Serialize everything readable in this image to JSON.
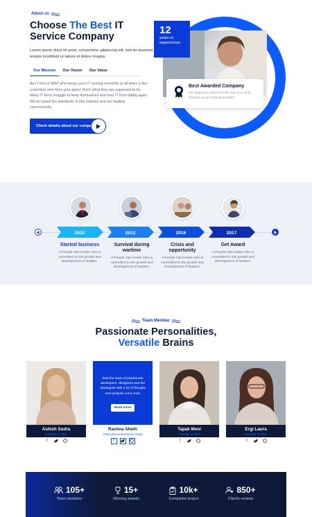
{
  "about": {
    "eyebrow": "About us",
    "title_pre": "Choose ",
    "title_hl": "The Best",
    "title_post": " IT Service Company",
    "lead": "Lorem ipsum dolor sit amet, consectetur adipiscing elit, sed do eiusmod tempor incididunt ut labore et dolore magna.",
    "tabs": [
      "Our Mission",
      "Our Vision",
      "Our Value"
    ],
    "tab_body": "An IT firm or MSP who keeps your IT running smoothly at all times is like a plumber who fixes your pipes; that's what they are supposed to do. Many IT firms struggle to keep themselves and their IT from falling apart. We've raised the standards in this industry and are leading cybersecurity.",
    "cta_label": "Check details about our company",
    "years_num": "12",
    "years_label": "years of experiences",
    "award_title": "Best Awarded Company",
    "award_desc": "We adapt our delivery to the way your work, whether as an external provider."
  },
  "timeline": {
    "items": [
      {
        "year": "2010",
        "title": "Started business",
        "desc": "A People Ops leader who is committed to the growth and development of leaders.",
        "color": "#19b5f5"
      },
      {
        "year": "2012",
        "title": "Survival during wartime",
        "desc": "A People Ops leader who is committed to the growth and development of leaders.",
        "color": "#1a7ff0"
      },
      {
        "year": "2016",
        "title": "Crisis and opportunity",
        "desc": "A People Ops leader who is committed to the growth and development of leaders.",
        "color": "#0b4fe0"
      },
      {
        "year": "2017",
        "title": "Get Award",
        "desc": "A People Ops leader who is committed to the growth and development of leaders.",
        "color": "#0b2fb0"
      }
    ]
  },
  "team": {
    "eyebrow": "Team Member",
    "title_line1": "Passionate Personalities,",
    "title_hl": "Versatile",
    "title_post": " Brains",
    "members": [
      {
        "name": "Ashish Sudra",
        "role": "Founder & CEO"
      },
      {
        "name": "Rachna Sheth",
        "role": "International Business Head",
        "overlay_text": "lead the team of passionate developers, designers and the strategists with a lot of thought and analysis come true!",
        "overlay_btn": "Read more"
      },
      {
        "name": "Tapak Meni",
        "role": "Founder & CEO"
      },
      {
        "name": "Ergi Laura",
        "role": "Founder & CEO"
      }
    ]
  },
  "stats": [
    {
      "value": "105+",
      "label": "Team members",
      "icon": "team-icon"
    },
    {
      "value": "15+",
      "label": "Winning awards",
      "icon": "trophy-icon"
    },
    {
      "value": "10k+",
      "label": "Completed project",
      "icon": "clipboard-icon"
    },
    {
      "value": "850+",
      "label": "Client's reviews",
      "icon": "reviews-icon"
    }
  ],
  "colors": {
    "accent": "#0b5cff",
    "brand": "#0b3bd6",
    "dark": "#0d1a3a"
  }
}
